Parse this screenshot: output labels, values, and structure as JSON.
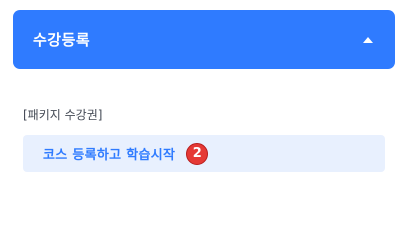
{
  "colors": {
    "accent": "#2f7bff",
    "item_background": "#e8f0fe",
    "badge": "#e53935"
  },
  "header": {
    "title": "수강등록",
    "toggle_icon": "caret-up-icon"
  },
  "section": {
    "label": "[패키지 수강권]",
    "items": [
      {
        "label": "코스 등록하고 학습시작",
        "badge": "2"
      }
    ]
  }
}
